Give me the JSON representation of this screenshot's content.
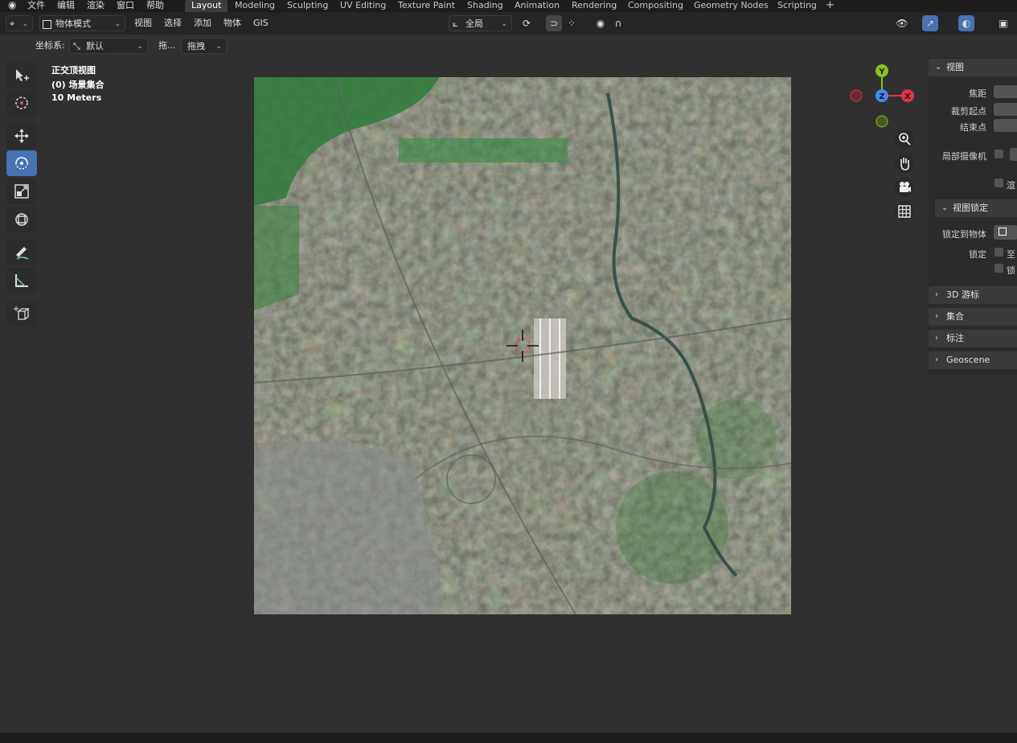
{
  "menu": [
    "文件",
    "编辑",
    "渲染",
    "窗口",
    "帮助"
  ],
  "workspaces": [
    "Layout",
    "Modeling",
    "Sculpting",
    "UV Editing",
    "Texture Paint",
    "Shading",
    "Animation",
    "Rendering",
    "Compositing",
    "Geometry Nodes",
    "Scripting"
  ],
  "workspace_add": "+",
  "header": {
    "mode": "物体模式",
    "menus": [
      "视图",
      "选择",
      "添加",
      "物体",
      "GIS"
    ],
    "transform_orientation": "全局"
  },
  "toolsettings": {
    "coord_label": "坐标系:",
    "coord_value": "默认",
    "drag_label": "拖...",
    "drag_value": "拖拽"
  },
  "viewport_overlay": {
    "view_name": "正交顶视图",
    "collection": "(0) 场景集合",
    "scale": "10 Meters"
  },
  "gizmo": {
    "y": "Y",
    "z": "Z",
    "x": "X"
  },
  "sidebar": {
    "view_panel": "视图",
    "focal_label": "焦距",
    "clip_start_label": "裁剪起点",
    "clip_end_label": "结束点",
    "local_camera_label": "局部摄像机",
    "render_region_label": "渲",
    "view_lock_panel": "视图锁定",
    "lock_to_object_label": "锁定到物体",
    "lock_label": "锁定",
    "lock_opt1": "至",
    "lock_opt2": "锁",
    "panels": [
      "3D 游标",
      "集合",
      "标注",
      "Geoscene"
    ]
  },
  "colors": {
    "accent_blue": "#4772b3",
    "axis_x": "#e0344a",
    "axis_y": "#8cbf26",
    "axis_z": "#3d8cf0"
  }
}
